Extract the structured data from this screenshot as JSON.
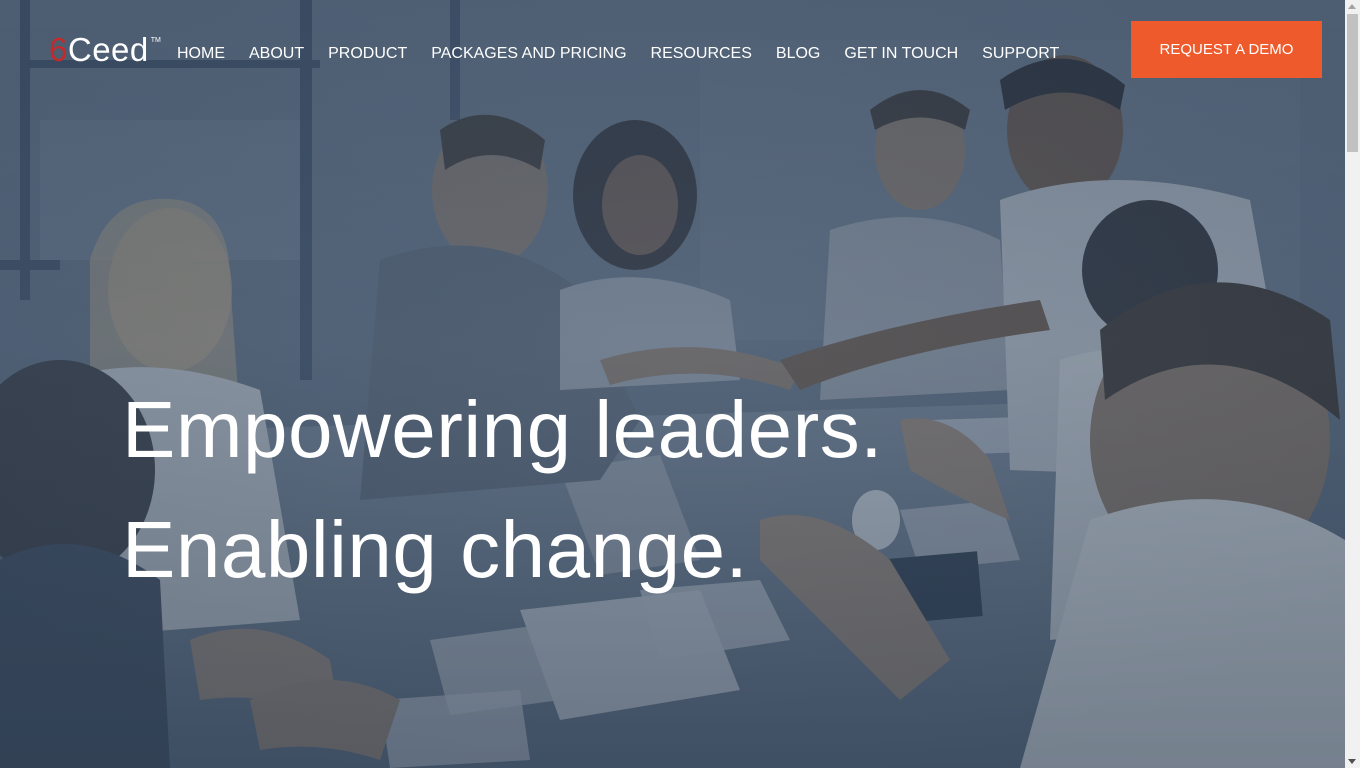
{
  "header": {
    "logo": {
      "six": "6",
      "name": "Ceed",
      "tm": "TM"
    },
    "nav": [
      {
        "label": "HOME"
      },
      {
        "label": "ABOUT"
      },
      {
        "label": "PRODUCT"
      },
      {
        "label": "PACKAGES AND PRICING"
      },
      {
        "label": "RESOURCES"
      },
      {
        "label": "BLOG"
      },
      {
        "label": "GET IN TOUCH"
      },
      {
        "label": "SUPPORT"
      }
    ],
    "cta_label": "REQUEST A DEMO"
  },
  "hero": {
    "line1": "Empowering leaders.",
    "line2": "Enabling change.",
    "background_description_icon": "team-meeting-photo"
  },
  "colors": {
    "brand_accent": "#ef5a2d",
    "logo_red": "#c32a2a",
    "overlay": "#34475e"
  }
}
